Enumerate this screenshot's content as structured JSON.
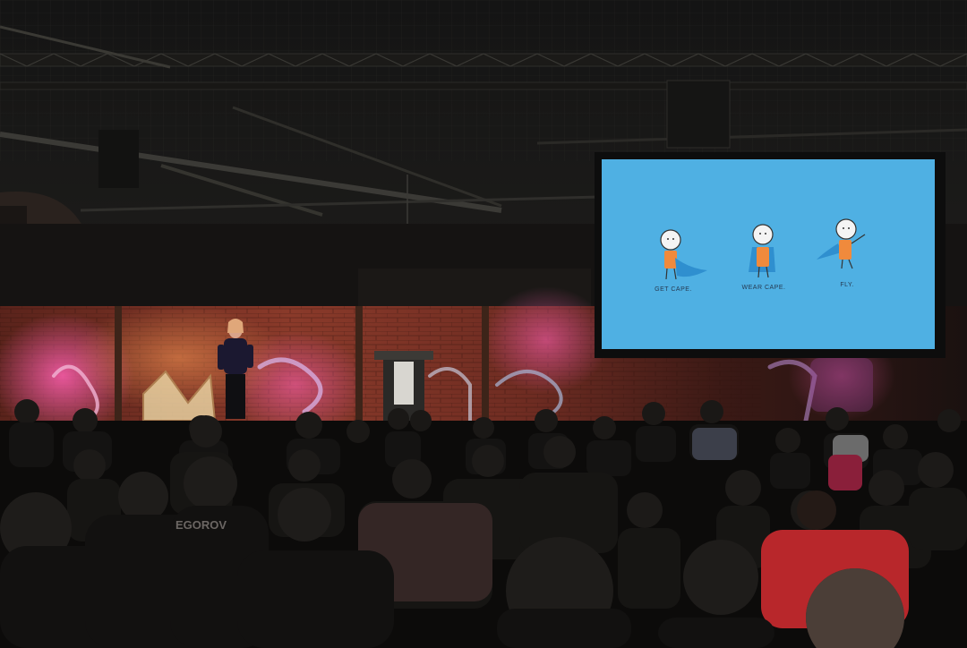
{
  "scene": {
    "subject": "Conference talk",
    "screen": {
      "background": "#4fb0e3",
      "captions": [
        "GET CAPE.",
        "WEAR CAPE.",
        "FLY."
      ]
    },
    "podium_text": "",
    "shirt_text": "EGOROV",
    "colors": {
      "brick": "#8a3a2a",
      "stage_light": "#d9468a",
      "figure_orange": "#f08a3c",
      "cape_blue": "#2f8fcf"
    }
  }
}
